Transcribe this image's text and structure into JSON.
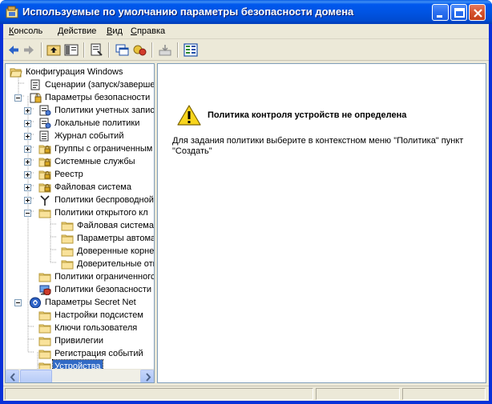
{
  "window": {
    "title": "Используемые по умолчанию параметры безопасности домена"
  },
  "menu": {
    "items": [
      {
        "label": "Консоль",
        "key": "К"
      },
      {
        "label": "Действие",
        "key": "Д"
      },
      {
        "label": "Вид",
        "key": "В"
      },
      {
        "label": "Справка",
        "key": "С"
      }
    ]
  },
  "tree": {
    "items": [
      {
        "label": "Конфигурация Windows",
        "level": 0,
        "icon": "folder-open-icon",
        "expander": "none"
      },
      {
        "label": "Сценарии (запуск/завершени",
        "level": 1,
        "icon": "script-icon",
        "expander": "none"
      },
      {
        "label": "Параметры безопасности",
        "level": 1,
        "icon": "security-icon",
        "expander": "minus"
      },
      {
        "label": "Политики учетных запис",
        "level": 2,
        "icon": "policy-icon",
        "expander": "plus"
      },
      {
        "label": "Локальные политики",
        "level": 2,
        "icon": "policy-icon",
        "expander": "plus"
      },
      {
        "label": "Журнал событий",
        "level": 2,
        "icon": "log-icon",
        "expander": "plus"
      },
      {
        "label": "Группы с ограниченным д",
        "level": 2,
        "icon": "folder-lock-icon",
        "expander": "plus"
      },
      {
        "label": "Системные службы",
        "level": 2,
        "icon": "folder-lock-icon",
        "expander": "plus"
      },
      {
        "label": "Реестр",
        "level": 2,
        "icon": "folder-lock-icon",
        "expander": "plus"
      },
      {
        "label": "Файловая система",
        "level": 2,
        "icon": "folder-lock-icon",
        "expander": "plus"
      },
      {
        "label": "Политики беспроводной",
        "level": 2,
        "icon": "antenna-icon",
        "expander": "plus"
      },
      {
        "label": "Политики открытого кл",
        "level": 2,
        "icon": "folder-icon",
        "expander": "minus"
      },
      {
        "label": "Файловая система EF",
        "level": 3,
        "icon": "folder-icon",
        "expander": "none"
      },
      {
        "label": "Параметры автомати",
        "level": 3,
        "icon": "folder-icon",
        "expander": "none"
      },
      {
        "label": "Доверенные корневы",
        "level": 3,
        "icon": "folder-icon",
        "expander": "none"
      },
      {
        "label": "Доверительные отнс",
        "level": 3,
        "icon": "folder-icon",
        "expander": "none"
      },
      {
        "label": "Политики ограниченногс",
        "level": 2,
        "icon": "folder-icon",
        "expander": "none"
      },
      {
        "label": "Политики безопасности I",
        "level": 2,
        "icon": "shield-computer-icon",
        "expander": "none"
      },
      {
        "label": "Параметры Secret Net",
        "level": 1,
        "icon": "secretnet-icon",
        "expander": "minus"
      },
      {
        "label": "Настройки подсистем",
        "level": 2,
        "icon": "folder-icon",
        "expander": "none"
      },
      {
        "label": "Ключи гользователя",
        "level": 2,
        "icon": "folder-icon",
        "expander": "none"
      },
      {
        "label": "Привилегии",
        "level": 2,
        "icon": "folder-icon",
        "expander": "none"
      },
      {
        "label": "Регистрация событий",
        "level": 2,
        "icon": "folder-icon",
        "expander": "none"
      },
      {
        "label": "Устройства",
        "level": 2,
        "icon": "folder-icon",
        "expander": "none",
        "selected": true
      }
    ]
  },
  "content": {
    "title": "Политика контроля устройств не определена",
    "body": "Для задания политики выберите в контекстном меню \"Политика\" пункт \"Создать\""
  },
  "colors": {
    "selection": "#316ac5",
    "titlebar": "#0054e3",
    "face": "#ece9d8"
  }
}
